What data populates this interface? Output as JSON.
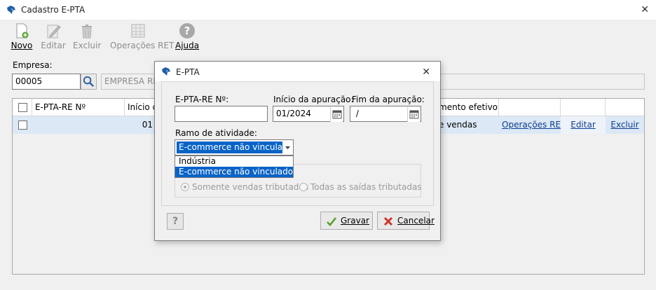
{
  "window": {
    "title": "Cadastro E-PTA",
    "close_icon": "close-icon"
  },
  "toolbar": {
    "novo": "Novo",
    "editar": "Editar",
    "excluir": "Excluir",
    "operacoes_ret": "Operações RET",
    "ajuda": "Ajuda"
  },
  "empresa": {
    "label": "Empresa:",
    "code": "00005",
    "name": "EMPRESA RET"
  },
  "grid": {
    "headers": {
      "epta": "E-PTA-RE Nº",
      "inicio": "Início d",
      "movimento": "mento efetivo"
    },
    "row": {
      "inicio": "01",
      "movimento": "e vendas",
      "operacoes": "Operações RET",
      "editar": "Editar",
      "excluir": "Excluir"
    }
  },
  "dialog": {
    "title": "E-PTA",
    "epta_label": "E-PTA-RE Nº:",
    "epta_value": "",
    "inicio_label": "Início da apuração:",
    "inicio_value": "01/2024",
    "fim_label": "Fim da apuração:",
    "fim_value": " /",
    "ramo_label": "Ramo de atividade:",
    "ramo_selected": "E-commerce não vinculado",
    "ramo_options": [
      "Indústria",
      "E-commerce não vinculado"
    ],
    "radio1": "Somente vendas tributadas",
    "radio2": "Todas as saídas tributadas",
    "help": "?",
    "gravar": "Gravar",
    "cancelar": "Cancelar"
  },
  "colors": {
    "accent": "#0a64c8",
    "row_highlight": "#dce8f5",
    "link": "#0b3d91"
  }
}
